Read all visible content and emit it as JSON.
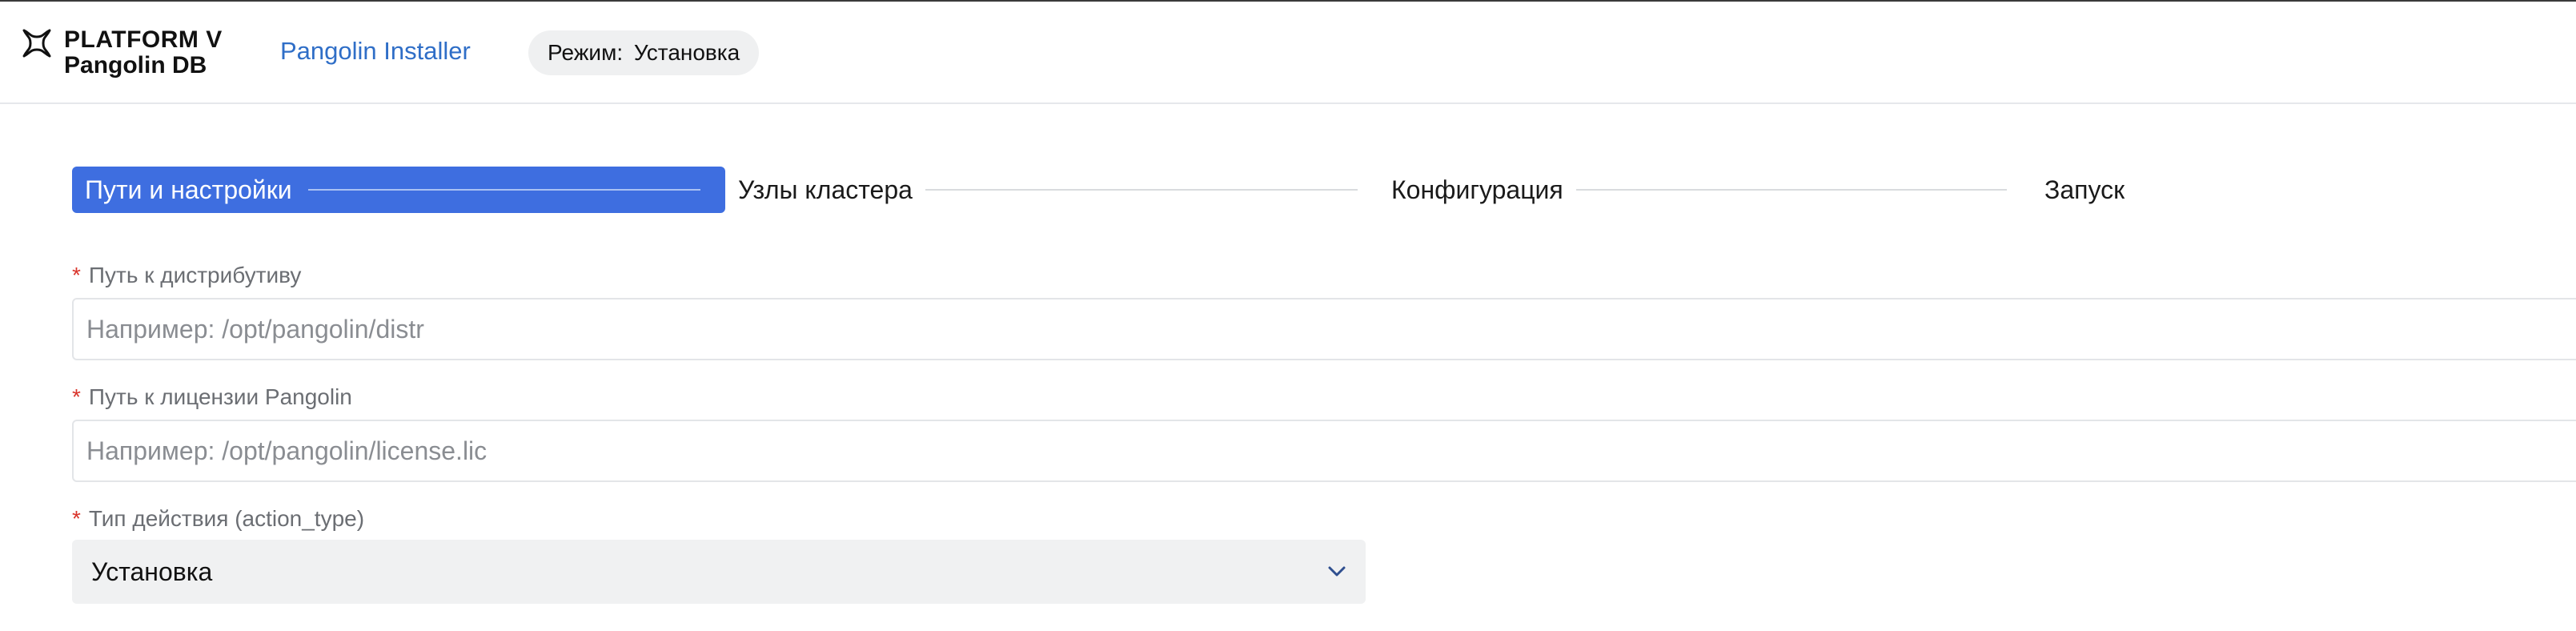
{
  "header": {
    "brand_line1": "PLATFORM V",
    "brand_line2": "Pangolin DB",
    "app_link": "Pangolin Installer",
    "mode_prefix": "Режим:",
    "mode_value": "Установка"
  },
  "stepper": {
    "steps": [
      {
        "label": "Пути и настройки",
        "active": true
      },
      {
        "label": "Узлы кластера",
        "active": false
      },
      {
        "label": "Конфигурация",
        "active": false
      },
      {
        "label": "Запуск",
        "active": false
      }
    ]
  },
  "form": {
    "distr": {
      "label": "Путь к дистрибутиву",
      "required_mark": "*",
      "placeholder": "Например: /opt/pangolin/distr",
      "value": ""
    },
    "license": {
      "label": "Путь к лицензии Pangolin",
      "required_mark": "*",
      "placeholder": "Например: /opt/pangolin/license.lic",
      "value": ""
    },
    "action_type": {
      "label": "Тип действия (action_type)",
      "required_mark": "*",
      "selected": "Установка"
    }
  },
  "colors": {
    "accent": "#3e6ee0",
    "link": "#2f6ec7",
    "required": "#d9342b"
  }
}
